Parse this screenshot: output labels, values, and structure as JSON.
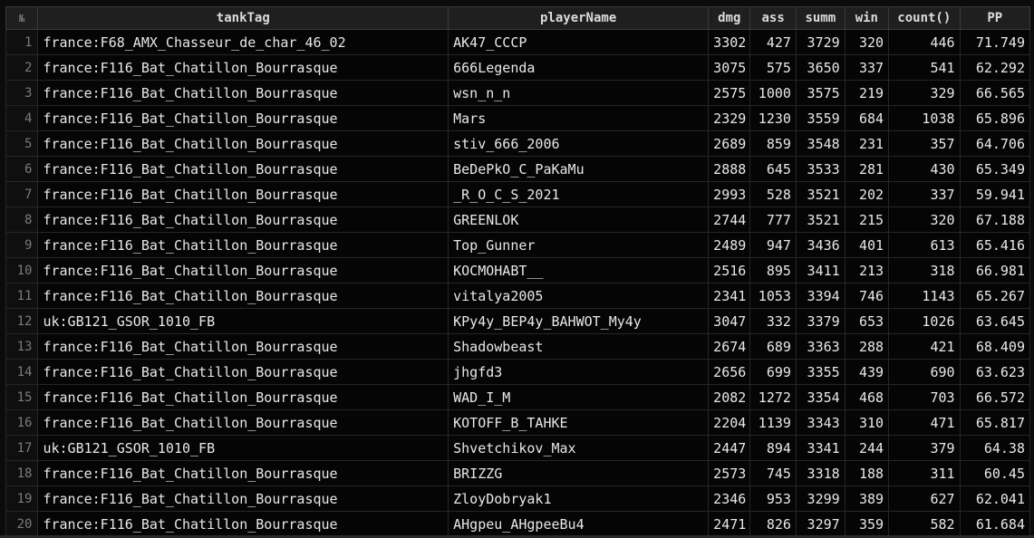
{
  "table": {
    "columns": [
      {
        "key": "idx",
        "label": "№"
      },
      {
        "key": "tankTag",
        "label": "tankTag"
      },
      {
        "key": "playerName",
        "label": "playerName"
      },
      {
        "key": "dmg",
        "label": "dmg"
      },
      {
        "key": "ass",
        "label": "ass"
      },
      {
        "key": "summ",
        "label": "summ"
      },
      {
        "key": "win",
        "label": "win"
      },
      {
        "key": "count",
        "label": "count()"
      },
      {
        "key": "pp",
        "label": "PP"
      }
    ],
    "rows": [
      [
        "1",
        "france:F68_AMX_Chasseur_de_char_46_02",
        "AK47_CCCP",
        "3302",
        "427",
        "3729",
        "320",
        "446",
        "71.749"
      ],
      [
        "2",
        "france:F116_Bat_Chatillon_Bourrasque",
        "666Legenda",
        "3075",
        "575",
        "3650",
        "337",
        "541",
        "62.292"
      ],
      [
        "3",
        "france:F116_Bat_Chatillon_Bourrasque",
        "wsn_n_n",
        "2575",
        "1000",
        "3575",
        "219",
        "329",
        "66.565"
      ],
      [
        "4",
        "france:F116_Bat_Chatillon_Bourrasque",
        "Mars",
        "2329",
        "1230",
        "3559",
        "684",
        "1038",
        "65.896"
      ],
      [
        "5",
        "france:F116_Bat_Chatillon_Bourrasque",
        "stiv_666_2006",
        "2689",
        "859",
        "3548",
        "231",
        "357",
        "64.706"
      ],
      [
        "6",
        "france:F116_Bat_Chatillon_Bourrasque",
        "BeDePkO_C_PaKaMu",
        "2888",
        "645",
        "3533",
        "281",
        "430",
        "65.349"
      ],
      [
        "7",
        "france:F116_Bat_Chatillon_Bourrasque",
        "_R_O_C_S_2021",
        "2993",
        "528",
        "3521",
        "202",
        "337",
        "59.941"
      ],
      [
        "8",
        "france:F116_Bat_Chatillon_Bourrasque",
        "GREENLOK",
        "2744",
        "777",
        "3521",
        "215",
        "320",
        "67.188"
      ],
      [
        "9",
        "france:F116_Bat_Chatillon_Bourrasque",
        "Top_Gunner",
        "2489",
        "947",
        "3436",
        "401",
        "613",
        "65.416"
      ],
      [
        "10",
        "france:F116_Bat_Chatillon_Bourrasque",
        "KOCMOHABT__",
        "2516",
        "895",
        "3411",
        "213",
        "318",
        "66.981"
      ],
      [
        "11",
        "france:F116_Bat_Chatillon_Bourrasque",
        "vitalya2005",
        "2341",
        "1053",
        "3394",
        "746",
        "1143",
        "65.267"
      ],
      [
        "12",
        "uk:GB121_GSOR_1010_FB",
        "KPy4y_BEP4y_BAHWOT_My4y",
        "3047",
        "332",
        "3379",
        "653",
        "1026",
        "63.645"
      ],
      [
        "13",
        "france:F116_Bat_Chatillon_Bourrasque",
        "Shadowbeast",
        "2674",
        "689",
        "3363",
        "288",
        "421",
        "68.409"
      ],
      [
        "14",
        "france:F116_Bat_Chatillon_Bourrasque",
        "jhgfd3",
        "2656",
        "699",
        "3355",
        "439",
        "690",
        "63.623"
      ],
      [
        "15",
        "france:F116_Bat_Chatillon_Bourrasque",
        "WAD_I_M",
        "2082",
        "1272",
        "3354",
        "468",
        "703",
        "66.572"
      ],
      [
        "16",
        "france:F116_Bat_Chatillon_Bourrasque",
        "KOTOFF_B_TAHKE",
        "2204",
        "1139",
        "3343",
        "310",
        "471",
        "65.817"
      ],
      [
        "17",
        "uk:GB121_GSOR_1010_FB",
        "Shvetchikov_Max",
        "2447",
        "894",
        "3341",
        "244",
        "379",
        "64.38"
      ],
      [
        "18",
        "france:F116_Bat_Chatillon_Bourrasque",
        "BRIZZG",
        "2573",
        "745",
        "3318",
        "188",
        "311",
        "60.45"
      ],
      [
        "19",
        "france:F116_Bat_Chatillon_Bourrasque",
        "ZloyDobryak1",
        "2346",
        "953",
        "3299",
        "389",
        "627",
        "62.041"
      ],
      [
        "20",
        "france:F116_Bat_Chatillon_Bourrasque",
        "AHgpeu_AHgpeeBu4",
        "2471",
        "826",
        "3297",
        "359",
        "582",
        "61.684"
      ]
    ]
  }
}
